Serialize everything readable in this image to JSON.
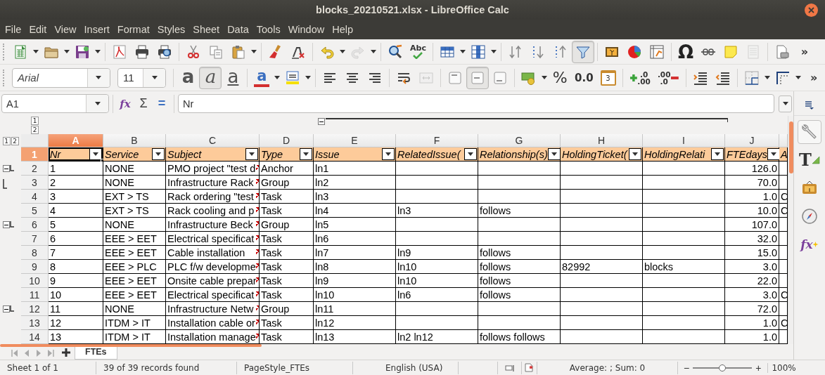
{
  "title_bar": {
    "title": "blocks_20210521.xlsx - LibreOffice Calc"
  },
  "menu": [
    "File",
    "Edit",
    "View",
    "Insert",
    "Format",
    "Styles",
    "Sheet",
    "Data",
    "Tools",
    "Window",
    "Help"
  ],
  "standard_toolbar": [
    {
      "kind": "new",
      "dropdown": true,
      "pressed": false,
      "disabled": false
    },
    {
      "kind": "open",
      "dropdown": true,
      "pressed": false,
      "disabled": false
    },
    {
      "kind": "save",
      "dropdown": true,
      "pressed": false,
      "disabled": false
    },
    {
      "kind": "sep"
    },
    {
      "kind": "pdf",
      "pressed": false,
      "disabled": false
    },
    {
      "kind": "print",
      "pressed": false,
      "disabled": false
    },
    {
      "kind": "preview",
      "pressed": false,
      "disabled": false
    },
    {
      "kind": "sep"
    },
    {
      "kind": "cut",
      "pressed": false,
      "disabled": false
    },
    {
      "kind": "copy",
      "pressed": false,
      "disabled": false
    },
    {
      "kind": "paste",
      "dropdown": true,
      "pressed": false,
      "disabled": false
    },
    {
      "kind": "sep"
    },
    {
      "kind": "brush",
      "pressed": false,
      "disabled": false
    },
    {
      "kind": "clear",
      "pressed": false,
      "disabled": false
    },
    {
      "kind": "sep"
    },
    {
      "kind": "undo",
      "dropdown": true,
      "pressed": false,
      "disabled": false
    },
    {
      "kind": "redo",
      "dropdown": true,
      "pressed": false,
      "disabled": true
    },
    {
      "kind": "sep"
    },
    {
      "kind": "find",
      "pressed": false,
      "disabled": false
    },
    {
      "kind": "spell",
      "text": "Abc",
      "pressed": false,
      "disabled": false
    },
    {
      "kind": "sep"
    },
    {
      "kind": "rows",
      "dropdown": true,
      "pressed": false,
      "disabled": false
    },
    {
      "kind": "cols",
      "dropdown": true,
      "pressed": false,
      "disabled": false
    },
    {
      "kind": "sep"
    },
    {
      "kind": "sort",
      "pressed": false,
      "disabled": false
    },
    {
      "kind": "asc",
      "pressed": false,
      "disabled": false
    },
    {
      "kind": "desc",
      "pressed": false,
      "disabled": false
    },
    {
      "kind": "filter",
      "pressed": true,
      "disabled": false
    },
    {
      "kind": "sep"
    },
    {
      "kind": "image",
      "pressed": false,
      "disabled": false
    },
    {
      "kind": "chart",
      "pressed": false,
      "disabled": false
    },
    {
      "kind": "pivot",
      "pressed": false,
      "disabled": false
    },
    {
      "kind": "sep"
    },
    {
      "kind": "special",
      "text": "Ω",
      "pressed": false,
      "disabled": false
    },
    {
      "kind": "link",
      "pressed": false,
      "disabled": false
    },
    {
      "kind": "note",
      "pressed": false,
      "disabled": false
    },
    {
      "kind": "hf",
      "pressed": false,
      "disabled": true
    },
    {
      "kind": "sep"
    },
    {
      "kind": "printarea",
      "pressed": false,
      "disabled": false
    },
    {
      "kind": "more",
      "text": "»",
      "pressed": false,
      "disabled": false
    }
  ],
  "formatting_toolbar": [
    {
      "kind": "font-name",
      "value": "Arial"
    },
    {
      "kind": "font-size",
      "value": "11"
    },
    {
      "kind": "sep"
    },
    {
      "kind": "bold",
      "text": "a",
      "pressed": false,
      "disabled": false
    },
    {
      "kind": "italic",
      "text": "a",
      "pressed": true,
      "disabled": false
    },
    {
      "kind": "underline",
      "text": "a",
      "pressed": false,
      "disabled": false
    },
    {
      "kind": "sep"
    },
    {
      "kind": "fontcolor",
      "text": "a",
      "dropdown": true,
      "pressed": false,
      "disabled": false
    },
    {
      "kind": "highlight",
      "dropdown": true,
      "pressed": false,
      "disabled": false
    },
    {
      "kind": "sep"
    },
    {
      "kind": "left",
      "pressed": false,
      "disabled": false
    },
    {
      "kind": "center",
      "pressed": false,
      "disabled": false
    },
    {
      "kind": "right",
      "pressed": false,
      "disabled": false
    },
    {
      "kind": "sep"
    },
    {
      "kind": "wrap",
      "pressed": false,
      "disabled": false
    },
    {
      "kind": "merge",
      "pressed": false,
      "disabled": true
    },
    {
      "kind": "sep"
    },
    {
      "kind": "top",
      "pressed": false,
      "disabled": false
    },
    {
      "kind": "middle",
      "pressed": true,
      "disabled": false
    },
    {
      "kind": "bottom",
      "pressed": false,
      "disabled": false
    },
    {
      "kind": "sep"
    },
    {
      "kind": "currency",
      "dropdown": true,
      "pressed": false,
      "disabled": false
    },
    {
      "kind": "percent",
      "text": "%",
      "pressed": false,
      "disabled": false
    },
    {
      "kind": "number",
      "text": "0.0",
      "pressed": false,
      "disabled": false
    },
    {
      "kind": "date",
      "text": "3",
      "pressed": false,
      "disabled": false
    },
    {
      "kind": "sep"
    },
    {
      "kind": "adddec",
      "lines": [
        ".0",
        ".00"
      ],
      "pressed": false,
      "disabled": false
    },
    {
      "kind": "deldec",
      "lines": [
        ".00",
        ".0"
      ],
      "pressed": false,
      "disabled": false
    },
    {
      "kind": "sep"
    },
    {
      "kind": "indent",
      "pressed": false,
      "disabled": false
    },
    {
      "kind": "outdent",
      "pressed": false,
      "disabled": false
    },
    {
      "kind": "sep"
    },
    {
      "kind": "borders",
      "dropdown": true,
      "pressed": false,
      "disabled": false
    },
    {
      "kind": "borderstyle",
      "dropdown": true,
      "pressed": false,
      "disabled": false
    },
    {
      "kind": "more",
      "text": "»",
      "pressed": false,
      "disabled": false
    }
  ],
  "formula_bar": {
    "name_box": "A1",
    "function_wizard": "fx",
    "buttons": [
      "Σ",
      "="
    ],
    "content": "Nr"
  },
  "outline": {
    "column_levels": [
      "1",
      "2"
    ],
    "row_levels": [
      "1",
      "2"
    ]
  },
  "sheet": {
    "columns": [
      {
        "label": "A",
        "selected": true,
        "filter_button": true
      },
      {
        "label": "B",
        "selected": false,
        "filter_button": true
      },
      {
        "label": "C",
        "selected": false,
        "filter_button": true
      },
      {
        "label": "D",
        "selected": false,
        "filter_button": true
      },
      {
        "label": "E",
        "selected": false,
        "filter_button": true
      },
      {
        "label": "F",
        "selected": false,
        "filter_button": true
      },
      {
        "label": "G",
        "selected": false,
        "filter_button": true
      },
      {
        "label": "H",
        "selected": false,
        "filter_button": true
      },
      {
        "label": "I",
        "selected": false,
        "filter_button": true
      },
      {
        "label": "J",
        "selected": false,
        "filter_button": true
      },
      {
        "selected": false,
        "filter_button": false
      }
    ],
    "rows": [
      {
        "header": "1",
        "selected": true,
        "kind": "filter-header",
        "cells": [
          "Nr",
          "Service",
          "Subject",
          "Type",
          "Issue",
          "RelatedIssue(",
          "Relationship(s)",
          "HoldingTicket(",
          "HoldingRelati",
          "FTEdays",
          "A"
        ]
      },
      {
        "header": "2",
        "selected": false,
        "kind": "data",
        "collapse_button": true,
        "group_end": false,
        "subject_overflow": true,
        "cells": [
          "1",
          "NONE",
          "PMO project \"test d",
          "Anchor",
          "ln1",
          null,
          null,
          null,
          null,
          "126.0",
          null
        ]
      },
      {
        "header": "3",
        "selected": false,
        "kind": "data",
        "collapse_button": false,
        "group_end": true,
        "subject_overflow": true,
        "cells": [
          "2",
          "NONE",
          "Infrastructure Rack",
          "Group",
          "ln2",
          null,
          null,
          null,
          null,
          "70.0",
          null
        ]
      },
      {
        "header": "4",
        "selected": false,
        "kind": "data",
        "collapse_button": false,
        "group_end": false,
        "subject_overflow": true,
        "cells": [
          "3",
          "EXT > TS",
          "Rack ordering \"test",
          "Task",
          "ln3",
          null,
          null,
          null,
          null,
          "1.0",
          "C"
        ]
      },
      {
        "header": "5",
        "selected": false,
        "kind": "data",
        "collapse_button": false,
        "group_end": false,
        "subject_overflow": true,
        "cells": [
          "4",
          "EXT > TS",
          "Rack cooling and p",
          "Task",
          "ln4",
          "ln3",
          "follows",
          null,
          null,
          "10.0",
          "C"
        ]
      },
      {
        "header": "6",
        "selected": false,
        "kind": "data",
        "collapse_button": true,
        "group_end": false,
        "subject_overflow": true,
        "cells": [
          "5",
          "NONE",
          "Infrastructure Beck",
          "Group",
          "ln5",
          null,
          null,
          null,
          null,
          "107.0",
          null
        ]
      },
      {
        "header": "7",
        "selected": false,
        "kind": "data",
        "collapse_button": false,
        "group_end": false,
        "subject_overflow": true,
        "cells": [
          "6",
          "EEE > EET",
          "Electrical specificat",
          "Task",
          "ln6",
          null,
          null,
          null,
          null,
          "32.0",
          null
        ]
      },
      {
        "header": "8",
        "selected": false,
        "kind": "data",
        "collapse_button": false,
        "group_end": false,
        "subject_overflow": true,
        "cells": [
          "7",
          "EEE > EET",
          "Cable installation",
          "Task",
          "ln7",
          "ln9",
          "follows",
          null,
          null,
          "15.0",
          null
        ]
      },
      {
        "header": "9",
        "selected": false,
        "kind": "data",
        "collapse_button": false,
        "group_end": false,
        "subject_overflow": true,
        "cells": [
          "8",
          "EEE > PLC",
          "PLC f/w developme",
          "Task",
          "ln8",
          "ln10",
          "follows",
          "82992",
          "blocks",
          "3.0",
          null
        ]
      },
      {
        "header": "10",
        "selected": false,
        "kind": "data",
        "collapse_button": false,
        "group_end": false,
        "subject_overflow": true,
        "cells": [
          "9",
          "EEE > EET",
          "Onsite cable prepar",
          "Task",
          "ln9",
          "ln10",
          "follows",
          null,
          null,
          "22.0",
          null
        ]
      },
      {
        "header": "11",
        "selected": false,
        "kind": "data",
        "collapse_button": false,
        "group_end": false,
        "subject_overflow": true,
        "cells": [
          "10",
          "EEE > EET",
          "Electrical specificat",
          "Task",
          "ln10",
          "ln6",
          "follows",
          null,
          null,
          "3.0",
          "C"
        ]
      },
      {
        "header": "12",
        "selected": false,
        "kind": "data",
        "collapse_button": true,
        "group_end": false,
        "subject_overflow": true,
        "cells": [
          "11",
          "NONE",
          "Infrastructure Netw",
          "Group",
          "ln11",
          null,
          null,
          null,
          null,
          "72.0",
          null
        ]
      },
      {
        "header": "13",
        "selected": false,
        "kind": "data",
        "collapse_button": false,
        "group_end": false,
        "subject_overflow": true,
        "cells": [
          "12",
          "ITDM > IT",
          "Installation cable or",
          "Task",
          "ln12",
          null,
          null,
          null,
          null,
          "1.0",
          "C"
        ]
      },
      {
        "header": "14",
        "selected": false,
        "kind": "data",
        "collapse_button": false,
        "group_end": false,
        "subject_overflow": true,
        "cells": [
          "13",
          "ITDM > IT",
          "Installation manage",
          "Task",
          "ln13",
          "ln2 ln12",
          "follows follows",
          null,
          null,
          "1.0",
          null
        ]
      }
    ]
  },
  "sidebar": [
    {
      "kind": "properties",
      "selected": true
    },
    {
      "kind": "styles",
      "text": "T",
      "selected": false
    },
    {
      "kind": "gallery",
      "selected": false
    },
    {
      "kind": "navigator",
      "selected": false
    },
    {
      "kind": "functions",
      "text": "fx",
      "selected": false
    }
  ],
  "sheet_tabs": [
    {
      "label": "FTEs",
      "selected": true
    }
  ],
  "status_bar": {
    "sheet": "Sheet 1 of 1",
    "records": "39 of 39 records found",
    "page_style": "PageStyle_FTEs",
    "language": "English (USA)",
    "document_modified": true,
    "summary": "Average: ; Sum: 0",
    "zoom_out": "−",
    "zoom_in": "+",
    "zoom": {
      "level": 0.5
    },
    "zoom_text": "100%"
  }
}
